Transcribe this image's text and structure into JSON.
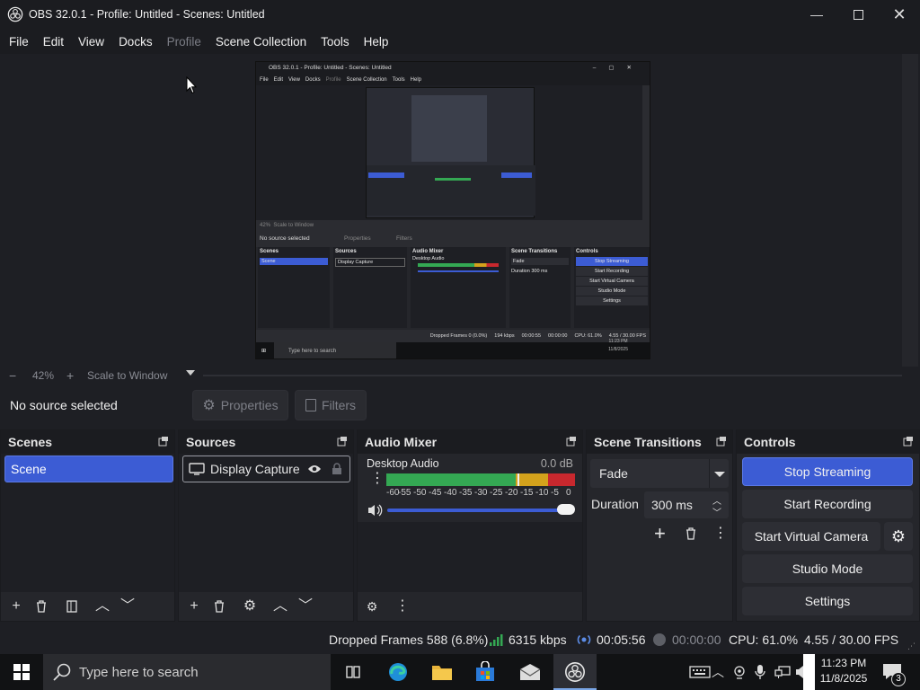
{
  "window": {
    "title": "OBS 32.0.1 - Profile: Untitled - Scenes: Untitled"
  },
  "menu": [
    "File",
    "Edit",
    "View",
    "Docks",
    "Profile",
    "Scene Collection",
    "Tools",
    "Help"
  ],
  "zoom": {
    "minus": "−",
    "percent": "42%",
    "plus": "+",
    "mode": "Scale to Window"
  },
  "source_bar": {
    "status": "No source selected",
    "properties": "Properties",
    "filters": "Filters"
  },
  "scenes": {
    "title": "Scenes",
    "items": [
      "Scene"
    ]
  },
  "sources": {
    "title": "Sources",
    "items": [
      "Display Capture"
    ]
  },
  "audio": {
    "title": "Audio Mixer",
    "channel": "Desktop Audio",
    "level": "0.0 dB",
    "ticks": [
      "-60",
      "-55",
      "-50",
      "-45",
      "-40",
      "-35",
      "-30",
      "-25",
      "-20",
      "-15",
      "-10",
      "-5",
      "0"
    ],
    "volume": 1.0
  },
  "transitions": {
    "title": "Scene Transitions",
    "selected": "Fade",
    "duration_label": "Duration",
    "duration_value": "300 ms"
  },
  "controls": {
    "title": "Controls",
    "stop_streaming": "Stop Streaming",
    "start_recording": "Start Recording",
    "start_virtual_camera": "Start Virtual Camera",
    "studio_mode": "Studio Mode",
    "settings": "Settings"
  },
  "status": {
    "dropped": "Dropped Frames 588 (6.8%)",
    "bitrate": "6315 kbps",
    "stream_time": "00:05:56",
    "rec_time": "00:00:00",
    "cpu": "CPU: 61.0%",
    "fps": "4.55 / 30.00 FPS"
  },
  "taskbar": {
    "search_placeholder": "Type here to search",
    "time": "11:23 PM",
    "date": "11/8/2025",
    "notifications": "3"
  },
  "preview_mini": {
    "title": "OBS 32.0.1 - Profile: Untitled - Scenes: Untitled",
    "menu": [
      "File",
      "Edit",
      "View",
      "Docks",
      "Profile",
      "Scene Collection",
      "Tools",
      "Help"
    ],
    "zoom": "42%",
    "zoom_mode": "Scale to Window",
    "no_source": "No source selected",
    "properties": "Properties",
    "filters": "Filters",
    "docks": [
      "Scenes",
      "Sources",
      "Audio Mixer",
      "Scene Transitions",
      "Controls"
    ],
    "scene": "Scene",
    "source": "Display Capture",
    "audio_channel": "Desktop Audio",
    "fade": "Fade",
    "duration": "Duration",
    "duration_value": "300 ms",
    "buttons": [
      "Stop Streaming",
      "Start Recording",
      "Start Virtual Camera",
      "Studio Mode",
      "Settings"
    ],
    "status": [
      "Dropped Frames 0 (0.0%)",
      "194 kbps",
      "00:00:55",
      "00:00:00",
      "CPU: 61.0%",
      "4.55 / 30.00 FPS"
    ],
    "search": "Type here to search",
    "time": "11:23 PM",
    "date": "11/8/2025"
  },
  "colors": {
    "accent": "#3c5cd4",
    "panel": "#25262b",
    "bg": "#1e1f24",
    "titlebar": "#1b1c20",
    "meter_green": "#34a853",
    "meter_yellow": "#d4a21c",
    "meter_red": "#c8282e"
  }
}
